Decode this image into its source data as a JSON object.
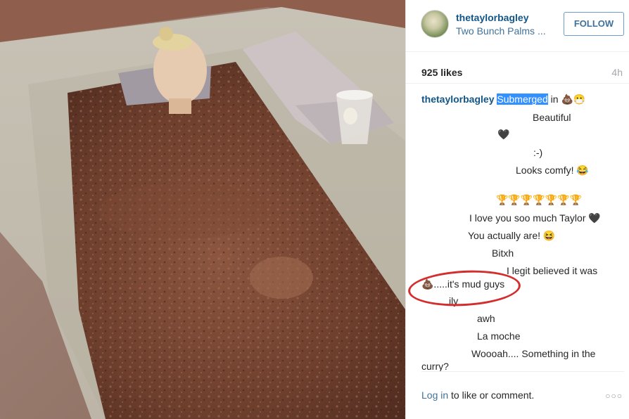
{
  "post": {
    "username": "thetaylorbagley",
    "location": "Two Bunch Palms ...",
    "follow_label": "FOLLOW",
    "likes": "925 likes",
    "time": "4h"
  },
  "caption": {
    "username": "thetaylorbagley",
    "highlight": "Submerged",
    "rest": " in ",
    "emoji": "💩😷"
  },
  "comments": [
    {
      "text": "Beautiful"
    },
    {
      "text": "🖤"
    },
    {
      "text": ":-)"
    },
    {
      "text": "Looks comfy! 😂"
    },
    {
      "text": "🏆🏆🏆🏆🏆🏆🏆"
    },
    {
      "text": "I love you soo much Taylor 🖤"
    },
    {
      "text": "You actually are! 😆"
    },
    {
      "text": "Bitxh"
    },
    {
      "text": "I legit believed it was"
    },
    {
      "text": "💩.....it's mud guys"
    },
    {
      "text": "ily"
    },
    {
      "text": "awh"
    },
    {
      "text": "La moche"
    },
    {
      "text": "Woooah.... Something in the"
    },
    {
      "text": "curry?"
    }
  ],
  "footer": {
    "login_link": "Log in",
    "login_rest": " to like or comment.",
    "more": "○○○"
  },
  "colors": {
    "username": "#125688",
    "link": "#3f729b",
    "highlight": "#3390ff",
    "annotation_ring": "#d42d2d"
  }
}
